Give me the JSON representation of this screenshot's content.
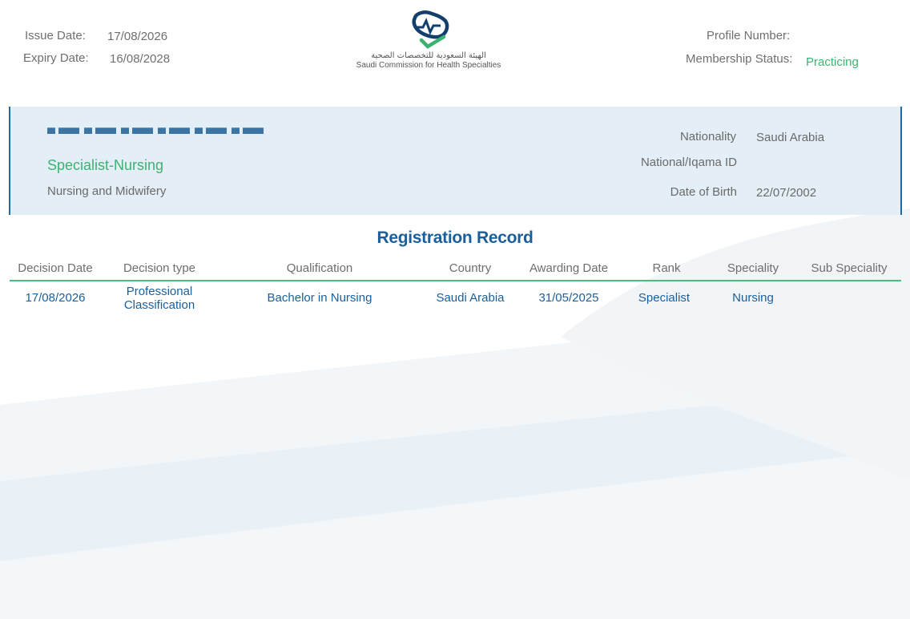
{
  "header": {
    "issue_date_label": "Issue Date:",
    "issue_date": "17/08/2026",
    "expiry_date_label": "Expiry Date:",
    "expiry_date": "16/08/2028",
    "profile_number_label": "Profile Number:",
    "profile_number": "",
    "membership_status_label": "Membership Status:",
    "membership_status": "Practicing"
  },
  "logo": {
    "arabic": "الهيئة السعودية للتخصصات الصحية",
    "english": "Saudi Commission for Health Specialties",
    "icon": "schs-logo-icon"
  },
  "profile": {
    "speciality_title": "Specialist-Nursing",
    "field": "Nursing and Midwifery",
    "nationality_label": "Nationality",
    "nationality": "Saudi Arabia",
    "national_id_label": "National/Iqama ID",
    "national_id": "",
    "dob_label": "Date of Birth",
    "dob": "22/07/2002"
  },
  "registration": {
    "title": "Registration Record",
    "columns": [
      "Decision Date",
      "Decision type",
      "Qualification",
      "Country",
      "Awarding Date",
      "Rank",
      "Speciality",
      "Sub Speciality"
    ],
    "rows": [
      {
        "decision_date": "17/08/2026",
        "decision_type_line1": "Professional",
        "decision_type_line2": "Classification",
        "qualification": "Bachelor in Nursing",
        "country": "Saudi Arabia",
        "awarding_date": "31/05/2025",
        "rank": "Specialist",
        "speciality": "Nursing",
        "sub_speciality": ""
      }
    ]
  },
  "colors": {
    "brand_blue": "#1a5f9c",
    "brand_green": "#3cb371",
    "panel_bg": "#e3eef6"
  }
}
